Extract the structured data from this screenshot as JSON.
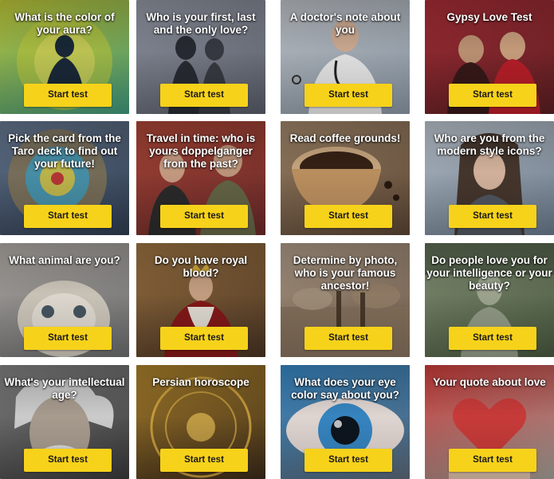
{
  "tests": [
    {
      "title": "What is the color of your aura?",
      "button_label": "Start test",
      "bg": "#3f9a80",
      "bg2": "#c9d23a",
      "icon": "aura-silhouette-icon"
    },
    {
      "title": "Who is your first, last and the only love?",
      "button_label": "Start test",
      "bg": "#5a5e6a",
      "bg2": "#9aa0ad",
      "icon": "couple-silhouette-icon"
    },
    {
      "title": "A doctor's note about you",
      "button_label": "Start test",
      "bg": "#8c9aa8",
      "bg2": "#c8ccd2",
      "icon": "doctor-icon"
    },
    {
      "title": "Gypsy Love Test",
      "button_label": "Start test",
      "bg": "#5a1f22",
      "bg2": "#b3303a",
      "icon": "gypsy-couple-icon"
    },
    {
      "title": "Pick the card from the Taro deck to find out your future!",
      "button_label": "Start test",
      "bg": "#2f3d52",
      "bg2": "#6b7d96",
      "icon": "tarot-wheel-icon"
    },
    {
      "title": "Travel in time: who is yours doppelganger from the past?",
      "button_label": "Start test",
      "bg": "#6b2a2a",
      "bg2": "#b54a3a",
      "icon": "historic-portrait-icon"
    },
    {
      "title": "Read coffee grounds!",
      "button_label": "Start test",
      "bg": "#5c4634",
      "bg2": "#a88c6e",
      "icon": "coffee-bowl-icon"
    },
    {
      "title": "Who are you from the modern style icons?",
      "button_label": "Start test",
      "bg": "#6a7b8e",
      "bg2": "#c5ced8",
      "icon": "woman-portrait-icon"
    },
    {
      "title": "What animal are you?",
      "button_label": "Start test",
      "bg": "#6e6f70",
      "bg2": "#b9b4ae",
      "icon": "grumpy-cat-icon"
    },
    {
      "title": "Do you have royal blood?",
      "button_label": "Start test",
      "bg": "#4a3424",
      "bg2": "#a57a45",
      "icon": "royal-portrait-icon"
    },
    {
      "title": "Determine by photo, who is your famous ancestor!",
      "button_label": "Start test",
      "bg": "#6f5a4a",
      "bg2": "#b7a38e",
      "icon": "battle-painting-icon"
    },
    {
      "title": "Do people love you for your intelligence or your beauty?",
      "button_label": "Start test",
      "bg": "#4a5a40",
      "bg2": "#8e9c7e",
      "icon": "statue-icon"
    },
    {
      "title": "What's your intellectual age?",
      "button_label": "Start test",
      "bg": "#3a3a3a",
      "bg2": "#8a8a8a",
      "icon": "einstein-icon"
    },
    {
      "title": "Persian horoscope",
      "button_label": "Start test",
      "bg": "#3b2a1a",
      "bg2": "#b78a2e",
      "icon": "zodiac-wheel-icon"
    },
    {
      "title": "What does your eye color say about you?",
      "button_label": "Start test",
      "bg": "#5d6b7a",
      "bg2": "#3a8fd0",
      "icon": "eye-icon"
    },
    {
      "title": "Your quote about love",
      "button_label": "Start test",
      "bg": "#a8a39c",
      "bg2": "#d8403e",
      "icon": "heart-icon"
    }
  ]
}
